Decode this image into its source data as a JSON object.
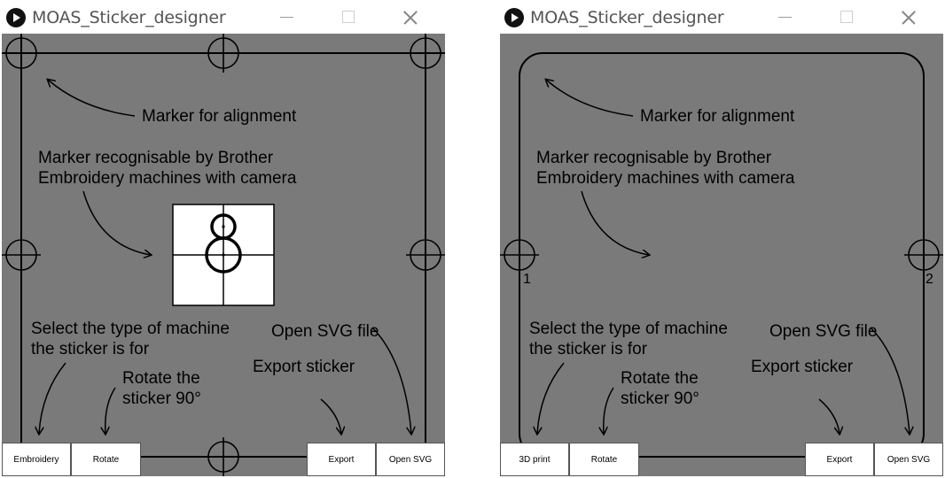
{
  "windows": [
    {
      "title": "MOAS_Sticker_designer",
      "annotations": {
        "marker_alignment": "Marker for alignment",
        "brother_line1": "Marker recognisable by Brother",
        "brother_line2": "Embroidery machines with camera",
        "select_line1": "Select the type of machine",
        "select_line2": "the sticker is for",
        "rotate_line1": "Rotate the",
        "rotate_line2": "sticker 90°",
        "export": "Export sticker",
        "open": "Open SVG file"
      },
      "buttons": {
        "machine": "Embroidery",
        "rotate": "Rotate",
        "export": "Export",
        "open_svg": "Open SVG"
      }
    },
    {
      "title": "MOAS_Sticker_designer",
      "annotations": {
        "marker_alignment": "Marker for alignment",
        "brother_line1": "Marker recognisable by Brother",
        "brother_line2": "Embroidery machines with camera",
        "select_line1": "Select the type of machine",
        "select_line2": "the sticker is for",
        "rotate_line1": "Rotate the",
        "rotate_line2": "sticker 90°",
        "export": "Export sticker",
        "open": "Open SVG file"
      },
      "marker_labels": {
        "left": "1",
        "right": "2"
      },
      "buttons": {
        "machine": "3D print",
        "rotate": "Rotate",
        "export": "Export",
        "open_svg": "Open SVG"
      }
    }
  ],
  "colors": {
    "canvas": "#7a7a7a",
    "outline": "#000000",
    "button_bg": "#ffffff"
  },
  "icons": {
    "app": "play-circle-icon",
    "minimize": "minimize-icon",
    "maximize": "maximize-icon",
    "close": "close-icon",
    "crosshair": "crosshair-marker-icon"
  }
}
